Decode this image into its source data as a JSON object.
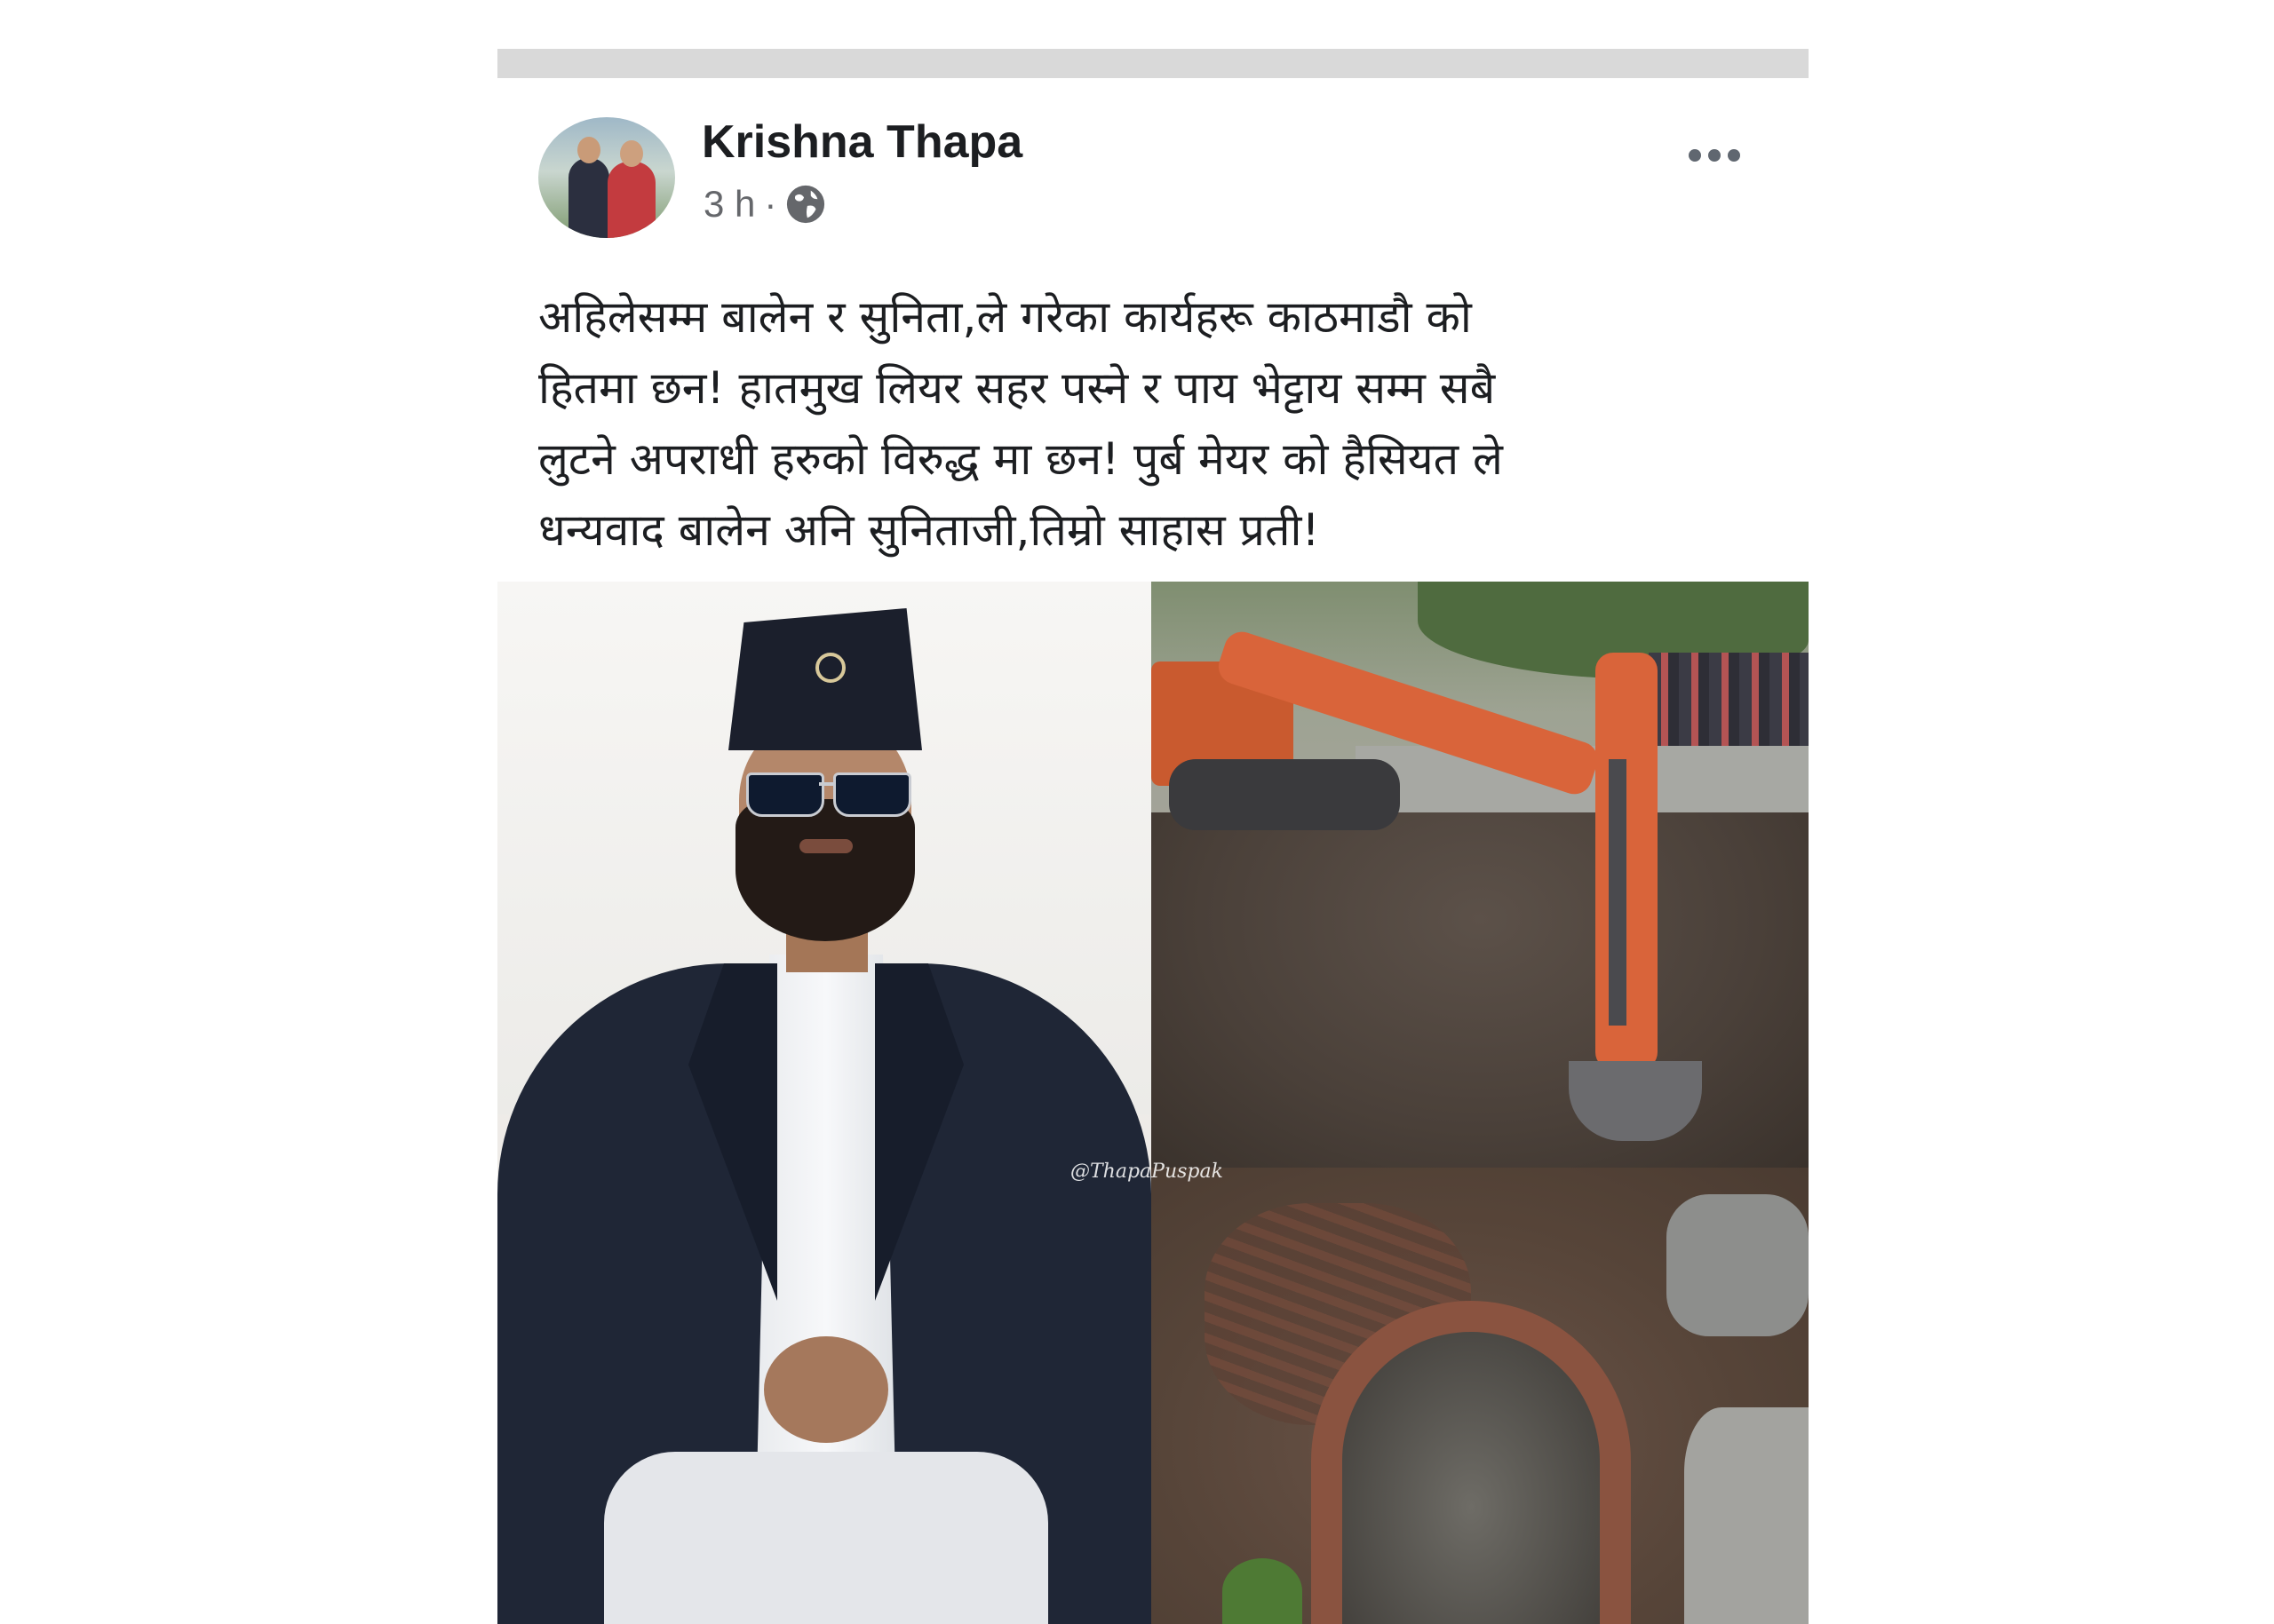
{
  "post": {
    "author": "Krishna Thapa",
    "time": "3 h",
    "separator": "·",
    "privacy_icon": "globe-icon",
    "more_icon": "more-options-icon",
    "text_lines": [
      "अहिलेसम्म बालेन र सुनिता,ले गरेका कार्यहरू काठमाडौ को",
      "हितमा छन! हातमुख लियर सहर पस्ने र पाय भेट्टाय सम्म सबै",
      "लुटने अपराधी हरुको विरुद्ध मा छन! पुर्ब मेयर को हैसियत ले",
      "धन्यवाद बालेन अनि सुनिताजी,तिम्रो साहास प्रती!"
    ],
    "media": {
      "watermark": "@ThapaPuspak"
    }
  },
  "colors": {
    "author_text": "#1c1e21",
    "meta_text": "#65676b",
    "top_bar": "#d9d9d9",
    "excavator_orange": "#d9643a"
  }
}
